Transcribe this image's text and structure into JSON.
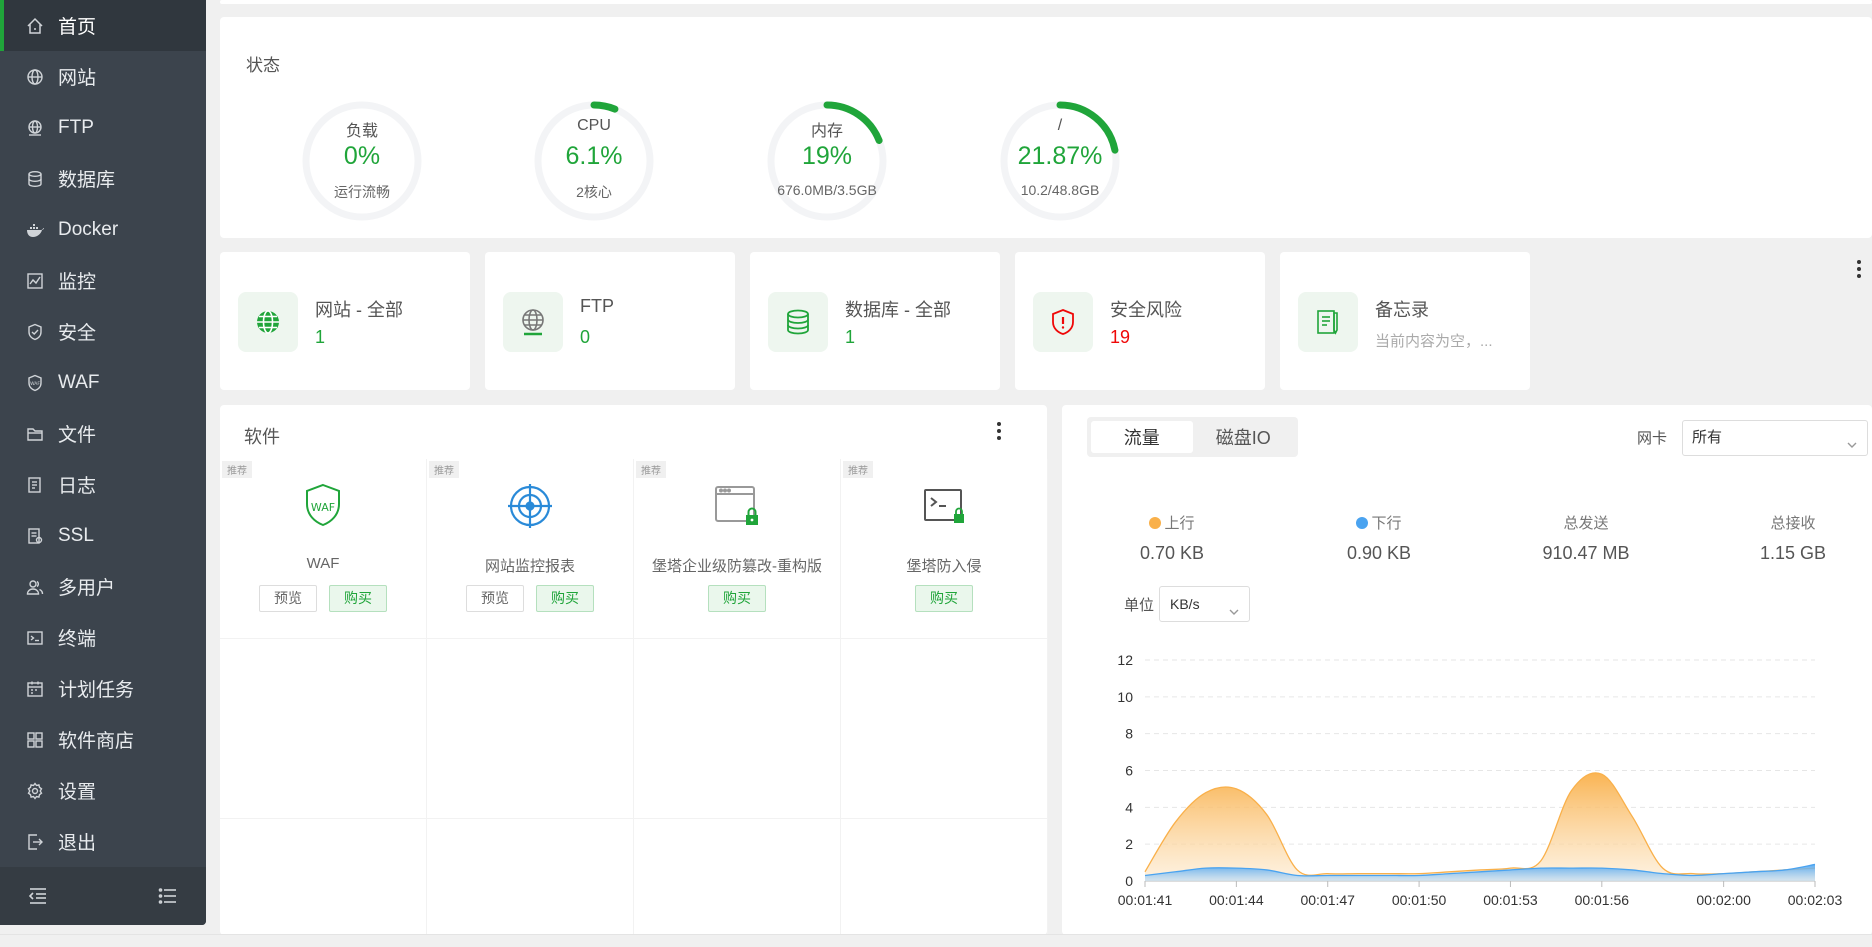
{
  "sidebar": {
    "items": [
      {
        "label": "首页",
        "icon": "home-icon"
      },
      {
        "label": "网站",
        "icon": "globe-icon"
      },
      {
        "label": "FTP",
        "icon": "ftp-icon"
      },
      {
        "label": "数据库",
        "icon": "database-icon"
      },
      {
        "label": "Docker",
        "icon": "docker-icon"
      },
      {
        "label": "监控",
        "icon": "monitor-icon"
      },
      {
        "label": "安全",
        "icon": "shield-icon"
      },
      {
        "label": "WAF",
        "icon": "waf-icon"
      },
      {
        "label": "文件",
        "icon": "folder-icon"
      },
      {
        "label": "日志",
        "icon": "log-icon"
      },
      {
        "label": "SSL",
        "icon": "ssl-icon"
      },
      {
        "label": "多用户",
        "icon": "users-icon"
      },
      {
        "label": "终端",
        "icon": "terminal-icon"
      },
      {
        "label": "计划任务",
        "icon": "calendar-icon"
      },
      {
        "label": "软件商店",
        "icon": "grid-icon"
      },
      {
        "label": "设置",
        "icon": "gear-icon"
      },
      {
        "label": "退出",
        "icon": "logout-icon"
      }
    ],
    "active_index": 0
  },
  "status": {
    "title": "状态",
    "gauges": [
      {
        "label": "负载",
        "value": "0%",
        "sub": "运行流畅",
        "percent": 0
      },
      {
        "label": "CPU",
        "value": "6.1%",
        "sub": "2核心",
        "percent": 6.1
      },
      {
        "label": "内存",
        "value": "19%",
        "sub": "676.0MB/3.5GB",
        "percent": 19
      },
      {
        "label": "/",
        "value": "21.87%",
        "sub": "10.2/48.8GB",
        "percent": 21.87
      }
    ]
  },
  "overview": [
    {
      "title": "网站 - 全部",
      "value": "1",
      "icon": "globe-icon"
    },
    {
      "title": "FTP",
      "value": "0",
      "icon": "ftp-icon"
    },
    {
      "title": "数据库 - 全部",
      "value": "1",
      "icon": "database-icon"
    },
    {
      "title": "安全风险",
      "value": "19",
      "icon": "shield-alert-icon"
    },
    {
      "title": "备忘录",
      "value": "当前内容为空，...",
      "icon": "memo-icon"
    }
  ],
  "software": {
    "title": "软件",
    "tag": "推荐",
    "preview_label": "预览",
    "buy_label": "购买",
    "items": [
      {
        "name": "WAF",
        "has_preview": true
      },
      {
        "name": "网站监控报表",
        "has_preview": true
      },
      {
        "name": "堡塔企业级防篡改-重构版",
        "has_preview": false
      },
      {
        "name": "堡塔防入侵",
        "has_preview": false
      }
    ]
  },
  "traffic": {
    "tabs": [
      "流量",
      "磁盘IO"
    ],
    "active_tab": 0,
    "nic_label": "网卡",
    "nic_value": "所有",
    "stats": [
      {
        "label": "上行",
        "value": "0.70 KB",
        "dot": "#f9b04a"
      },
      {
        "label": "下行",
        "value": "0.90 KB",
        "dot": "#4aa3f0"
      },
      {
        "label": "总发送",
        "value": "910.47 MB"
      },
      {
        "label": "总接收",
        "value": "1.15 GB"
      }
    ],
    "unit_label": "单位",
    "unit_value": "KB/s"
  },
  "colors": {
    "accent": "#20a53a",
    "danger": "#ef0808",
    "upload": "#f9b04a",
    "download": "#4aa3f0",
    "sidebar": "#3c444d"
  },
  "chart_data": {
    "type": "area",
    "x": [
      "00:01:41",
      "00:01:42",
      "00:01:43",
      "00:01:44",
      "00:01:45",
      "00:01:46",
      "00:01:47",
      "00:01:48",
      "00:01:49",
      "00:01:50",
      "00:01:51",
      "00:01:52",
      "00:01:53",
      "00:01:54",
      "00:01:55",
      "00:01:56",
      "00:01:57",
      "00:01:58",
      "00:01:59",
      "00:02:00",
      "00:02:01",
      "00:02:02",
      "00:02:03"
    ],
    "x_ticks": [
      "00:01:41",
      "00:01:44",
      "00:01:47",
      "00:01:50",
      "00:01:53",
      "00:01:56",
      "00:02:00",
      "00:02:03"
    ],
    "series": [
      {
        "name": "上行",
        "values": [
          0.5,
          3.2,
          4.8,
          5.0,
          3.6,
          0.6,
          0.4,
          0.4,
          0.4,
          0.4,
          0.5,
          0.6,
          0.7,
          1.1,
          4.9,
          5.8,
          3.5,
          0.7,
          0.4,
          0.4,
          0.5,
          0.6,
          0.7
        ]
      },
      {
        "name": "下行",
        "values": [
          0.3,
          0.5,
          0.7,
          0.7,
          0.6,
          0.3,
          0.3,
          0.3,
          0.3,
          0.3,
          0.4,
          0.5,
          0.6,
          0.7,
          0.7,
          0.7,
          0.6,
          0.4,
          0.3,
          0.4,
          0.5,
          0.6,
          0.9
        ]
      }
    ],
    "ylim": [
      0,
      12
    ],
    "yticks": [
      0,
      2,
      4,
      6,
      8,
      10,
      12
    ],
    "grid": true
  }
}
